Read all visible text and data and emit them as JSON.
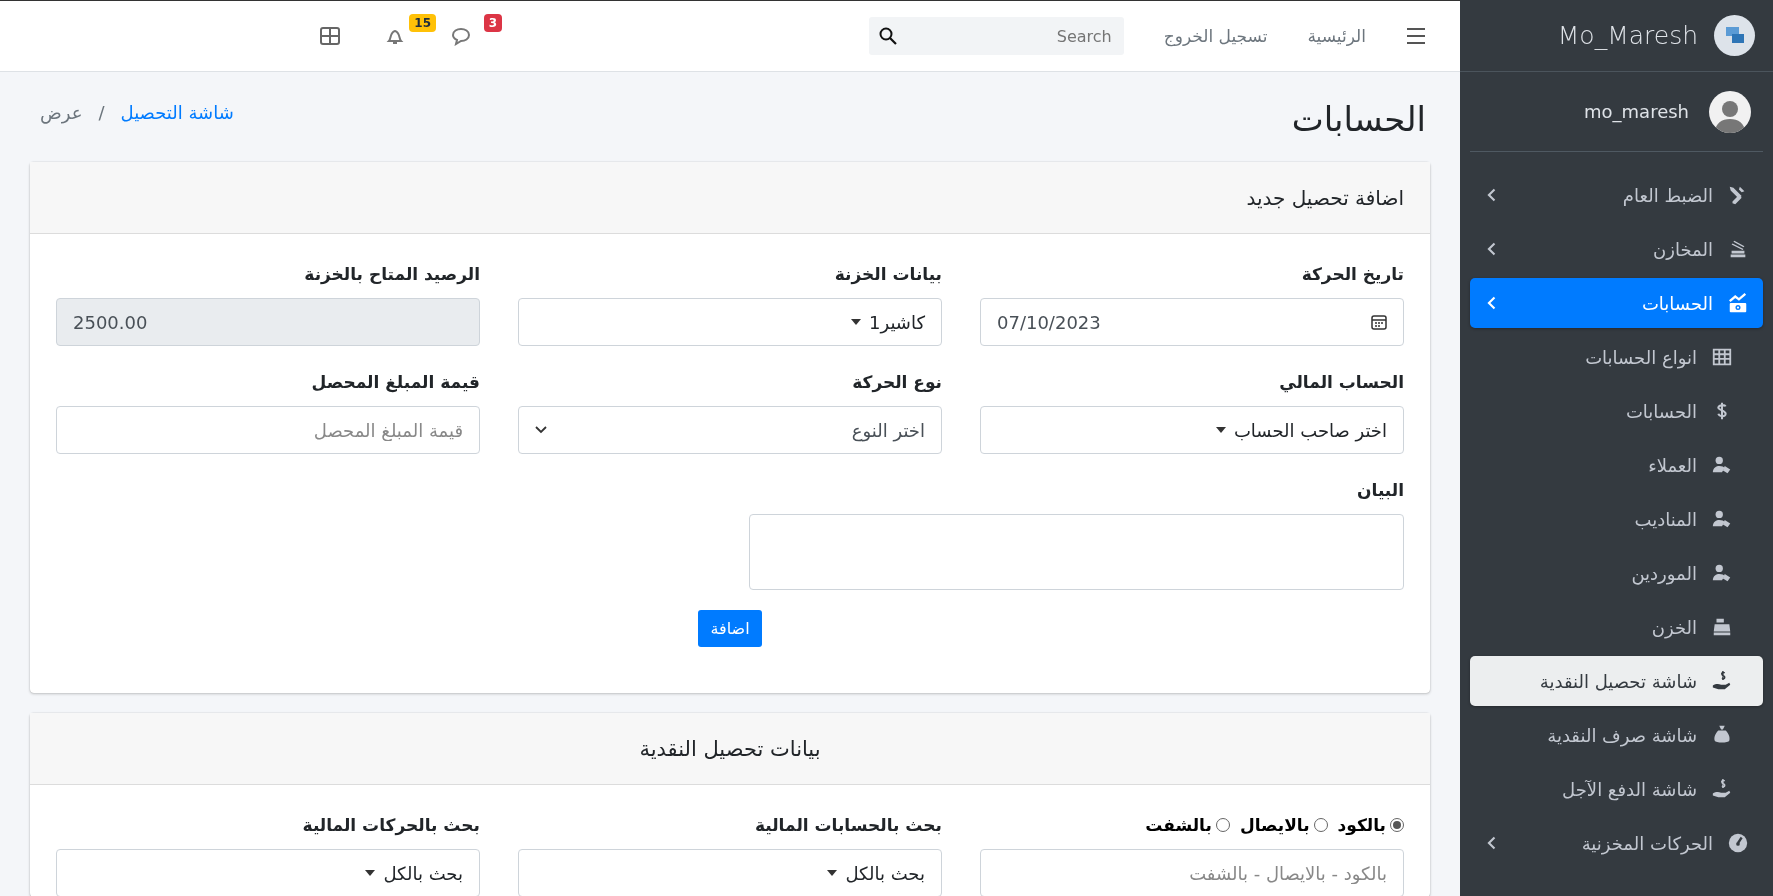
{
  "sidebar": {
    "brand": "Mo_Maresh",
    "user": "mo_maresh",
    "items": [
      {
        "label": "الضبط العام",
        "has_submenu": true,
        "selected": false
      },
      {
        "label": "المخازن",
        "has_submenu": true,
        "selected": false
      },
      {
        "label": "الحسابات",
        "has_submenu": true,
        "selected": true,
        "children": [
          {
            "label": "انواع الحسابات",
            "selected": false
          },
          {
            "label": "الحسابات",
            "selected": false
          },
          {
            "label": "العملاء",
            "selected": false
          },
          {
            "label": "المناديب",
            "selected": false
          },
          {
            "label": "الموردين",
            "selected": false
          },
          {
            "label": "الخزن",
            "selected": false
          },
          {
            "label": "شاشة تحصيل النقدية",
            "selected": true
          },
          {
            "label": "شاشة صرف النقدية",
            "selected": false
          },
          {
            "label": "شاشة الدفع الآجل",
            "selected": false
          }
        ]
      },
      {
        "label": "الحركات المخزنية",
        "has_submenu": true,
        "selected": false
      }
    ]
  },
  "navbar": {
    "links": [
      "الرئيسية",
      "تسجيل الخروج"
    ],
    "search": {
      "placeholder": "Search"
    },
    "notifications": [
      {
        "badge": "3",
        "color": "#dc3545"
      },
      {
        "badge": "15",
        "color": "#ffc107"
      }
    ]
  },
  "header": {
    "title": "الحسابات",
    "breadcrumb": [
      {
        "label": "شاشة التحصيل",
        "link": true
      },
      {
        "label": "عرض",
        "link": false
      }
    ],
    "separator": "/"
  },
  "form_card": {
    "title": "اضافة تحصيل جديد",
    "fields": [
      {
        "kind": "date",
        "label": "تاريخ الحركة",
        "value": "07/10/2023"
      },
      {
        "kind": "select",
        "label": "بيانات الخزنة",
        "value": "كاشير1"
      },
      {
        "kind": "readonly",
        "label": "الرصيد المتاح بالخزنة",
        "value": "2500.00"
      },
      {
        "kind": "select",
        "label": "الحساب المالي",
        "value": "اختر صاحب الحساب"
      },
      {
        "kind": "native-select",
        "label": "نوع الحركة",
        "value": "اختر النوع"
      },
      {
        "kind": "text",
        "label": "قيمة المبلغ المحصل",
        "placeholder": "قيمة المبلغ المحصل"
      },
      {
        "kind": "textarea",
        "label": "البيان"
      }
    ],
    "button": "اضافة"
  },
  "search_card": {
    "title": "بيانات تحصيل النقدية",
    "radios": [
      {
        "label": "بالكود",
        "selected": true
      },
      {
        "label": "بالايصال",
        "selected": false
      },
      {
        "label": "بالشفت",
        "selected": false
      }
    ],
    "search_placeholder": "بالكود - بالايصال - بالشفت",
    "filters": [
      {
        "label": "بحث بالحسابات المالية",
        "value": "بحث بالكل"
      },
      {
        "label": "بحث بالحركات المالية",
        "value": "بحث بالكل"
      }
    ]
  }
}
